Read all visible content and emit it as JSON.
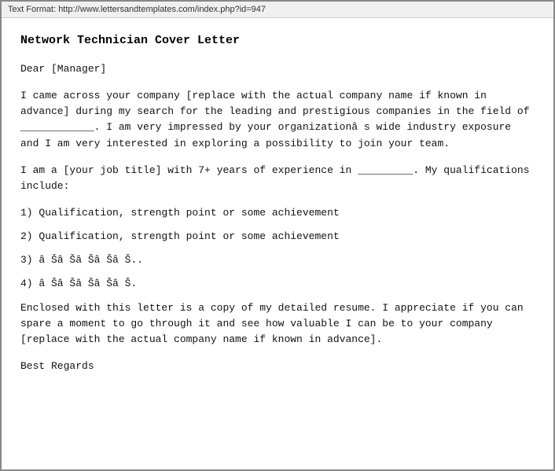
{
  "toolbar": {
    "label": "Text Format:",
    "url": "http://www.lettersandtemplates.com/index.php?id=947"
  },
  "document": {
    "title": "Network Technician Cover Letter",
    "salutation": "Dear [Manager]",
    "paragraph1": "I came across your company [replace with the actual company name if known in advance] during my search for the leading and prestigious companies in the field of ____________. I am very impressed by your organizationâ  s wide industry exposure and I am very interested in exploring a possibility to join your team.",
    "paragraph2": "I am a [your job title] with 7+ years of experience in _________. My qualifications include:",
    "list_item1": "1) Qualification, strength point or some achievement",
    "list_item2": "2) Qualification, strength point or some achievement",
    "list_item3": "3) â Šâ Šâ Šâ Šâ Š..",
    "list_item4": "4) â Šâ Šâ Šâ Šâ Š.",
    "paragraph3": "Enclosed with this letter is a copy of my detailed resume. I appreciate if you can spare a moment to go through it and see how valuable I can be to your company [replace with the actual company name if known in advance].",
    "closing": "Best Regards"
  }
}
